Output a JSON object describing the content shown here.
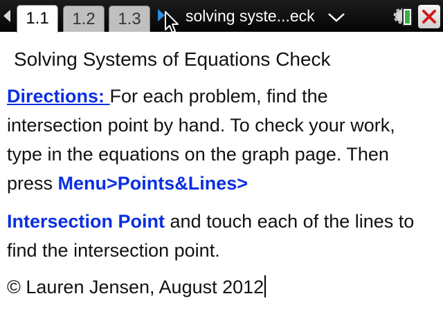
{
  "tabs": [
    {
      "label": "1.1",
      "active": true
    },
    {
      "label": "1.2",
      "active": false
    },
    {
      "label": "1.3",
      "active": false
    }
  ],
  "document_title": "solving syste...eck",
  "page_title": "Solving Systems of Equations Check",
  "directions": {
    "link_label": "Directions: ",
    "text_1": "For each problem, find the intersection point by hand. To check your work, type in the equations on the graph page. Then press ",
    "menu_path": "Menu>Points&Lines>",
    "menu_item": "Intersection Point",
    "text_2": " and touch each of the lines to find the intersection point."
  },
  "credit": "© Lauren Jensen, August 2012",
  "icons": [
    "nav-left-arrow-icon",
    "nav-right-arrow-icon",
    "mouse-cursor-icon",
    "dropdown-chevron-icon",
    "battery-settings-icon",
    "close-x-icon"
  ],
  "colors": {
    "link_blue": "#0a2fe0",
    "topbar": "#0a0a0a",
    "active_tab": "#ffffff",
    "inactive_tab": "#bfbfbf",
    "close_x": "#d11a1a",
    "battery_green": "#3cb043"
  }
}
